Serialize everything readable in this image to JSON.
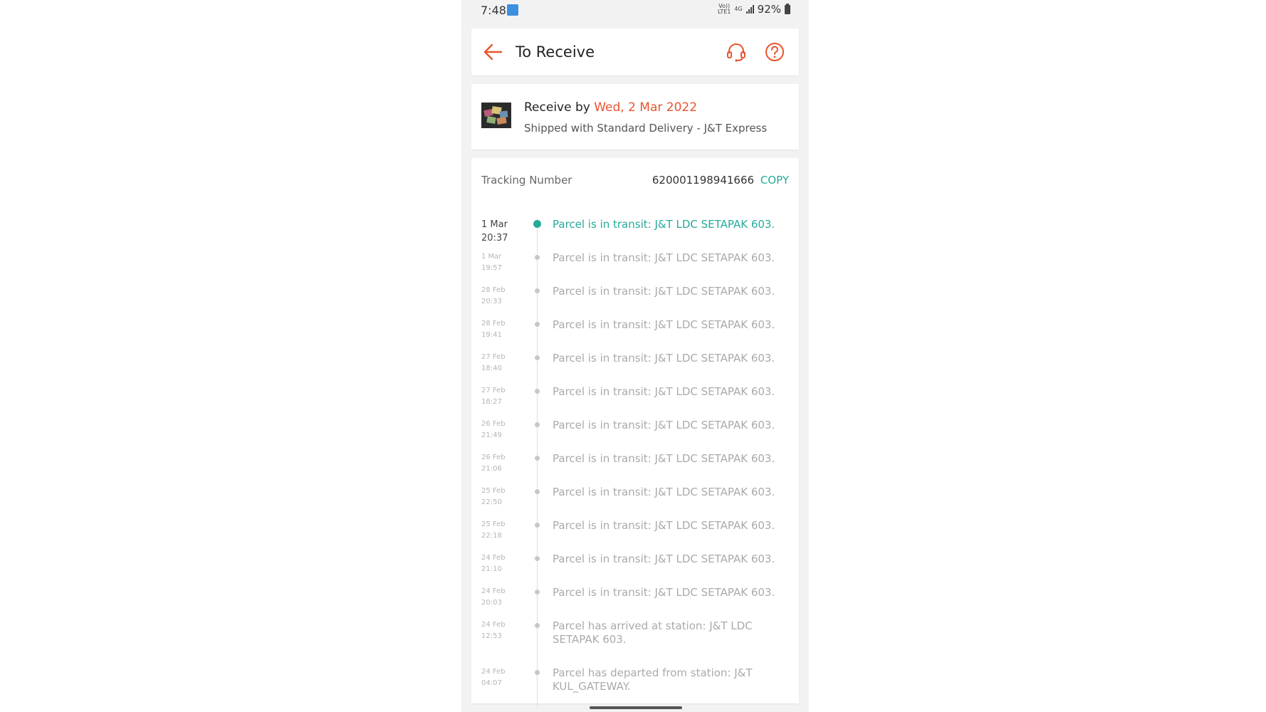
{
  "status_bar": {
    "time": "7:48",
    "volte_top": "Vo))",
    "volte_bottom": "LTE1",
    "network": "4G",
    "battery": "92%"
  },
  "header": {
    "title": "To Receive",
    "back_icon": "arrow-left-icon",
    "support_icon": "headset-icon",
    "help_icon": "question-circle-icon",
    "accent_color": "#e8542f"
  },
  "shipping": {
    "receive_prefix": "Receive by",
    "receive_date": "Wed, 2 Mar 2022",
    "shipped_with": "Shipped with Standard Delivery - J&T Express"
  },
  "tracking": {
    "label": "Tracking Number",
    "number": "620001198941666",
    "copy_label": "COPY",
    "active_color": "#26aa99",
    "events": [
      {
        "date": "1 Mar",
        "time": "20:37",
        "text": "Parcel is in transit: J&T LDC SETAPAK 603."
      },
      {
        "date": "1 Mar",
        "time": "19:57",
        "text": "Parcel is in transit: J&T LDC SETAPAK 603."
      },
      {
        "date": "28 Feb",
        "time": "20:33",
        "text": "Parcel is in transit: J&T LDC SETAPAK 603."
      },
      {
        "date": "28 Feb",
        "time": "19:41",
        "text": "Parcel is in transit: J&T LDC SETAPAK 603."
      },
      {
        "date": "27 Feb",
        "time": "18:40",
        "text": "Parcel is in transit: J&T LDC SETAPAK 603."
      },
      {
        "date": "27 Feb",
        "time": "18:27",
        "text": "Parcel is in transit: J&T LDC SETAPAK 603."
      },
      {
        "date": "26 Feb",
        "time": "21:49",
        "text": "Parcel is in transit: J&T LDC SETAPAK 603."
      },
      {
        "date": "26 Feb",
        "time": "21:06",
        "text": "Parcel is in transit: J&T LDC SETAPAK 603."
      },
      {
        "date": "25 Feb",
        "time": "22:50",
        "text": "Parcel is in transit: J&T LDC SETAPAK 603."
      },
      {
        "date": "25 Feb",
        "time": "22:18",
        "text": "Parcel is in transit: J&T LDC SETAPAK 603."
      },
      {
        "date": "24 Feb",
        "time": "21:10",
        "text": "Parcel is in transit: J&T LDC SETAPAK 603."
      },
      {
        "date": "24 Feb",
        "time": "20:03",
        "text": "Parcel is in transit: J&T LDC SETAPAK 603."
      },
      {
        "date": "24 Feb",
        "time": "12:53",
        "text": "Parcel has arrived at station: J&T LDC SETAPAK 603."
      },
      {
        "date": "24 Feb",
        "time": "04:07",
        "text": "Parcel has departed from station: J&T KUL_GATEWAY."
      }
    ]
  }
}
